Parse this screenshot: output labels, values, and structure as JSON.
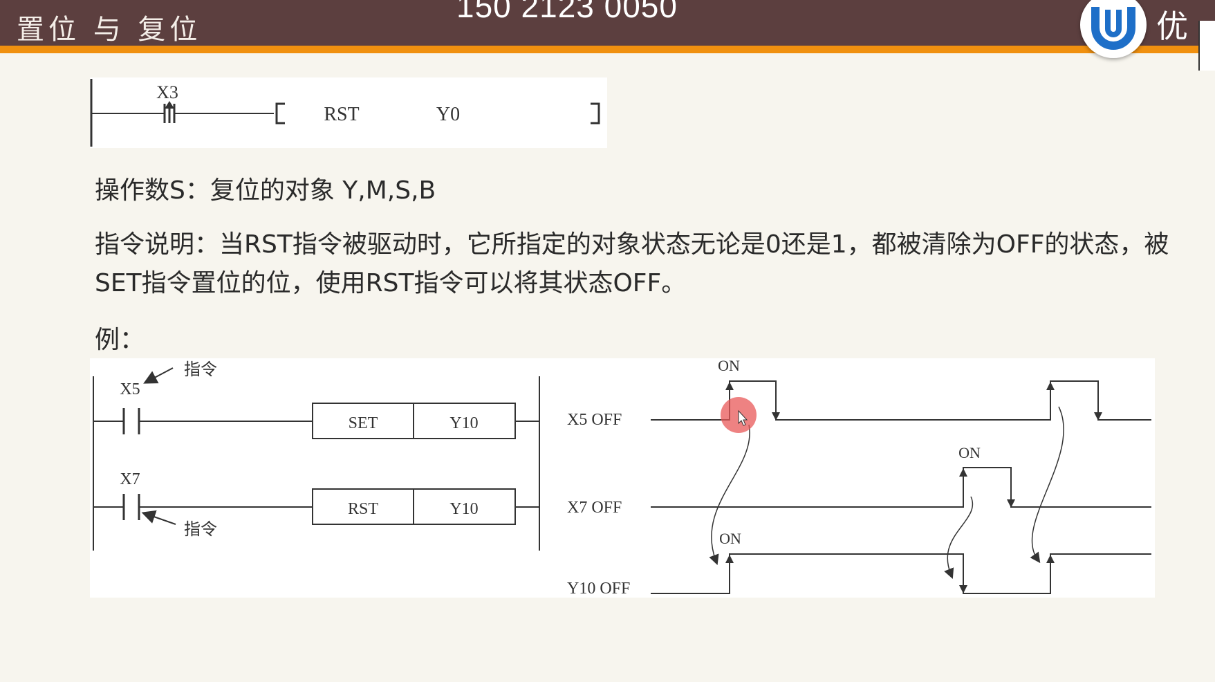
{
  "header": {
    "title": "置位 与 复位",
    "phone": "150 2123 0050",
    "logo_text": "优"
  },
  "ladder_top": {
    "contact_label": "X3",
    "instruction": "RST",
    "operand": "Y0"
  },
  "operand_text": "操作数S：复位的对象 Y,M,S,B",
  "description": "指令说明：当RST指令被驱动时，它所指定的对象状态无论是0还是1，都被清除为OFF的状态，被SET指令置位的位，使用RST指令可以将其状态OFF。",
  "example_label": "例：",
  "example": {
    "rung1_contact": "X5",
    "rung1_callout": "指令",
    "rung1_instruction": "SET",
    "rung1_operand": "Y10",
    "rung2_contact": "X7",
    "rung2_callout": "指令",
    "rung2_instruction": "RST",
    "rung2_operand": "Y10",
    "timing": {
      "x5_label": "X5  OFF",
      "x7_label": "X7  OFF",
      "y10_label": "Y10  OFF",
      "x5_on": "ON",
      "x7_on": "ON",
      "y10_on": "ON"
    }
  },
  "colors": {
    "header_bg": "#5c3f3f",
    "header_stripe": "#f0900f",
    "logo_blue": "#1e6fc8",
    "cursor_marker": "#e85858"
  }
}
